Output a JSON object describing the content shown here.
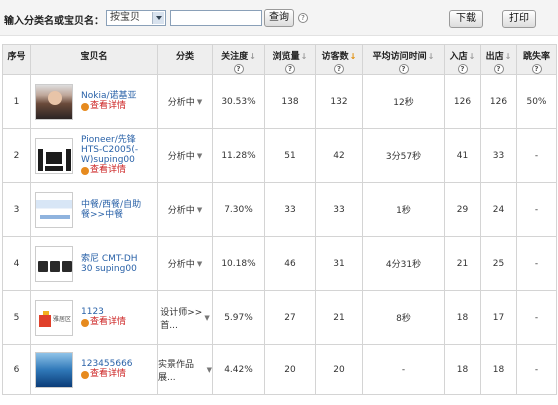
{
  "toolbar": {
    "search_label": "输入分类名或宝贝名：",
    "select_value": "按宝贝",
    "search_value": "",
    "query_label": "查询",
    "help_glyph": "?",
    "download_label": "下载",
    "print_label": "打印"
  },
  "table": {
    "headers": {
      "index": "序号",
      "item": "宝贝名",
      "category": "分类",
      "attention": "关注度",
      "views": "浏览量",
      "visitors": "访客数",
      "avg_time": "平均访问时间",
      "entries": "入店",
      "exits": "出店",
      "bounce": "跳失率"
    },
    "sort_glyph": "↓",
    "help_glyph": "?",
    "detail_label": "查看详情",
    "rows": [
      {
        "index": "1",
        "name": "Nokia/诺基亚",
        "category": "分析中",
        "attention": "30.53%",
        "views": "138",
        "visitors": "132",
        "avg_time": "12秒",
        "entries": "126",
        "exits": "126",
        "bounce": "50%"
      },
      {
        "index": "2",
        "name": "Pioneer/先锋\nHTS-C2005(-\nW)suping00",
        "category": "分析中",
        "attention": "11.28%",
        "views": "51",
        "visitors": "42",
        "avg_time": "3分57秒",
        "entries": "41",
        "exits": "33",
        "bounce": "-"
      },
      {
        "index": "3",
        "name": "中餐/西餐/自助\n餐>>中餐",
        "category": "分析中",
        "attention": "7.30%",
        "views": "33",
        "visitors": "33",
        "avg_time": "1秒",
        "entries": "29",
        "exits": "24",
        "bounce": "-"
      },
      {
        "index": "4",
        "name": "索尼  CMT-DH\n30 suping00",
        "category": "分析中",
        "attention": "10.18%",
        "views": "46",
        "visitors": "31",
        "avg_time": "4分31秒",
        "entries": "21",
        "exits": "25",
        "bounce": "-"
      },
      {
        "index": "5",
        "name": "1123",
        "category": "设计师>>\n首...",
        "attention": "5.97%",
        "views": "27",
        "visitors": "21",
        "avg_time": "8秒",
        "entries": "18",
        "exits": "17",
        "bounce": "-"
      },
      {
        "index": "6",
        "name": "123455666",
        "category": "实景作品展...",
        "attention": "4.42%",
        "views": "20",
        "visitors": "20",
        "avg_time": "-",
        "entries": "18",
        "exits": "18",
        "bounce": "-"
      }
    ]
  },
  "thumb5_text": "雅居区"
}
